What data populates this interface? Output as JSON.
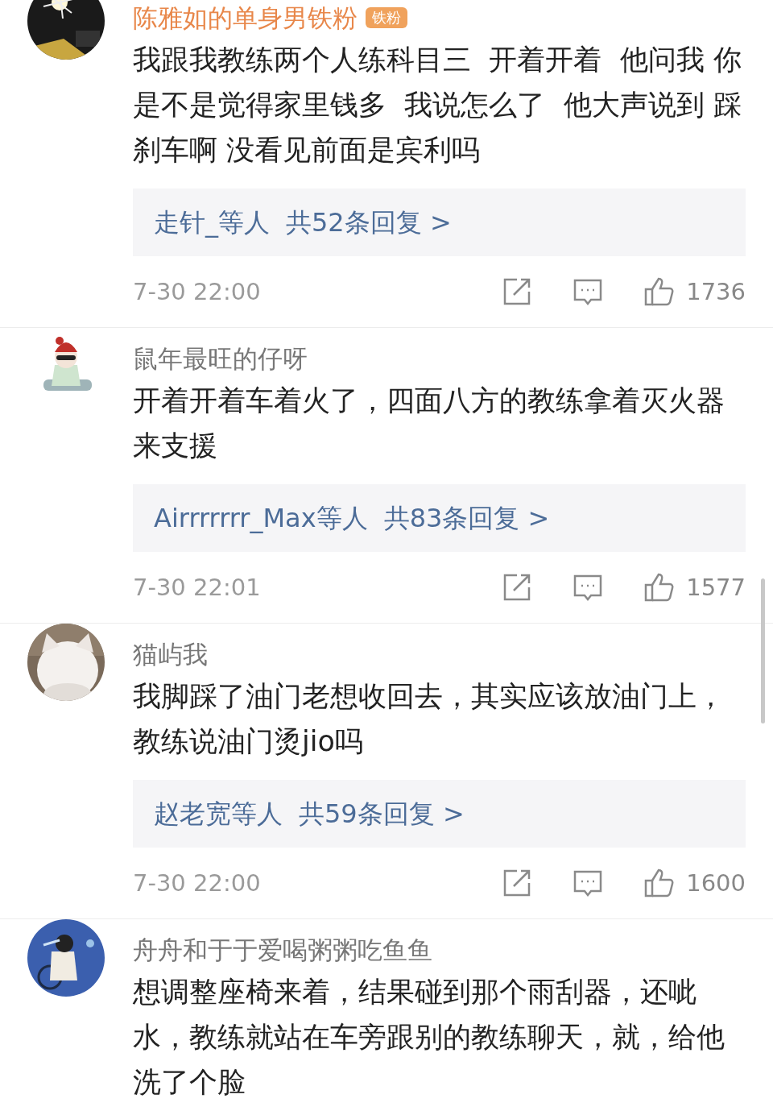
{
  "comments": [
    {
      "user": "陈雅如的单身男铁粉",
      "highlighted": true,
      "badge": "铁粉",
      "text": "我跟我教练两个人练科目三  开着开着  他问我 你是不是觉得家里钱多  我说怎么了  他大声说到 踩刹车啊 没看见前面是宾利吗",
      "replies": {
        "who": "走针_等人",
        "count": "共52条回复 >"
      },
      "time": "7-30 22:00",
      "likes": "1736"
    },
    {
      "user": "鼠年最旺的仔呀",
      "highlighted": false,
      "text": "开着开着车着火了，四面八方的教练拿着灭火器来支援",
      "replies": {
        "who": "Airrrrrrr_Max等人",
        "count": "共83条回复 >"
      },
      "time": "7-30 22:01",
      "likes": "1577"
    },
    {
      "user": "猫屿我",
      "highlighted": false,
      "text": "我脚踩了油门老想收回去，其实应该放油门上，教练说油门烫jio吗",
      "replies": {
        "who": "赵老宽等人",
        "count": "共59条回复 >"
      },
      "time": "7-30 22:00",
      "likes": "1600"
    },
    {
      "user": "舟舟和于于爱喝粥粥吃鱼鱼",
      "highlighted": false,
      "text": "想调整座椅来着，结果碰到那个雨刮器，还呲水，教练就站在车旁跟别的教练聊天，就，给他洗了个脸"
    }
  ]
}
